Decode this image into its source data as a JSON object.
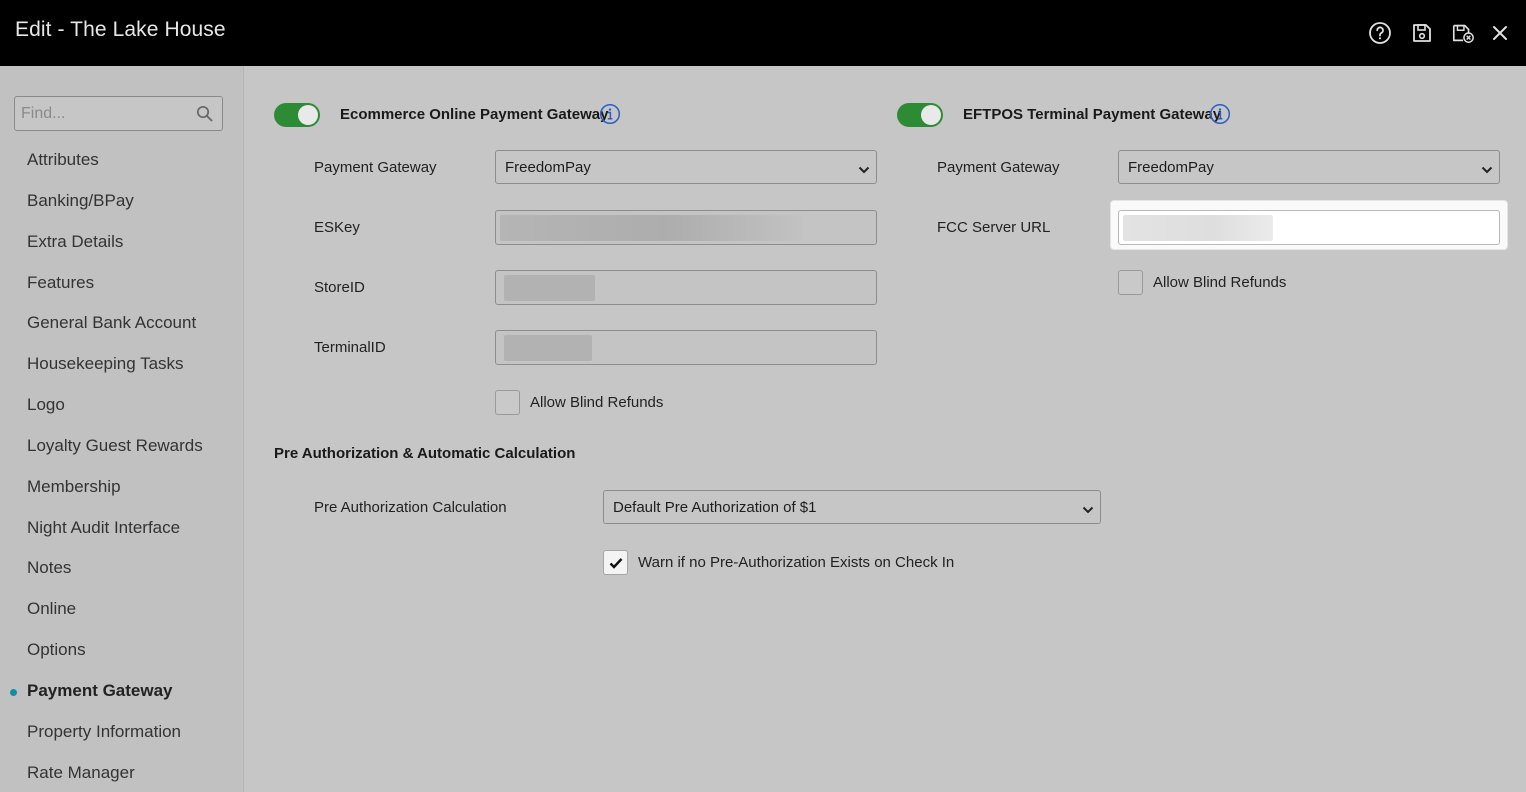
{
  "window": {
    "title": "Edit - The Lake House"
  },
  "titlebar_icons": [
    {
      "name": "help-icon"
    },
    {
      "name": "save-icon"
    },
    {
      "name": "save-and-close-icon"
    },
    {
      "name": "close-icon"
    }
  ],
  "sidebar": {
    "search_placeholder": "Find...",
    "items": [
      {
        "label": "Attributes",
        "active": false
      },
      {
        "label": "Banking/BPay",
        "active": false
      },
      {
        "label": "Extra Details",
        "active": false
      },
      {
        "label": "Features",
        "active": false
      },
      {
        "label": "General Bank Account",
        "active": false
      },
      {
        "label": "Housekeeping Tasks",
        "active": false
      },
      {
        "label": "Logo",
        "active": false
      },
      {
        "label": "Loyalty Guest Rewards",
        "active": false
      },
      {
        "label": "Membership",
        "active": false
      },
      {
        "label": "Night Audit Interface",
        "active": false
      },
      {
        "label": "Notes",
        "active": false
      },
      {
        "label": "Online",
        "active": false
      },
      {
        "label": "Options",
        "active": false
      },
      {
        "label": "Payment Gateway",
        "active": true
      },
      {
        "label": "Property Information",
        "active": false
      },
      {
        "label": "Rate Manager",
        "active": false
      }
    ]
  },
  "ecommerce": {
    "title": "Ecommerce Online Payment Gateway",
    "enabled": true,
    "payment_gateway_label": "Payment Gateway",
    "payment_gateway_value": "FreedomPay",
    "eskey_label": "ESKey",
    "storeid_label": "StoreID",
    "terminalid_label": "TerminalID",
    "allow_blind_refunds_label": "Allow Blind Refunds",
    "allow_blind_refunds_checked": false
  },
  "eftpos": {
    "title": "EFTPOS Terminal Payment Gateway",
    "enabled": true,
    "payment_gateway_label": "Payment Gateway",
    "payment_gateway_value": "FreedomPay",
    "fcc_server_url_label": "FCC Server URL",
    "allow_blind_refunds_label": "Allow Blind Refunds",
    "allow_blind_refunds_checked": false
  },
  "preauth": {
    "title": "Pre Authorization & Automatic Calculation",
    "calculation_label": "Pre Authorization Calculation",
    "calculation_value": "Default Pre Authorization of $1",
    "warn_label": "Warn if no Pre-Authorization Exists on Check In",
    "warn_checked": true
  },
  "colors": {
    "titlebar_bg": "#000000",
    "toggle_on": "#2e8b35",
    "active_dot": "#0e8fa7",
    "info_icon": "#2a5fc4"
  }
}
